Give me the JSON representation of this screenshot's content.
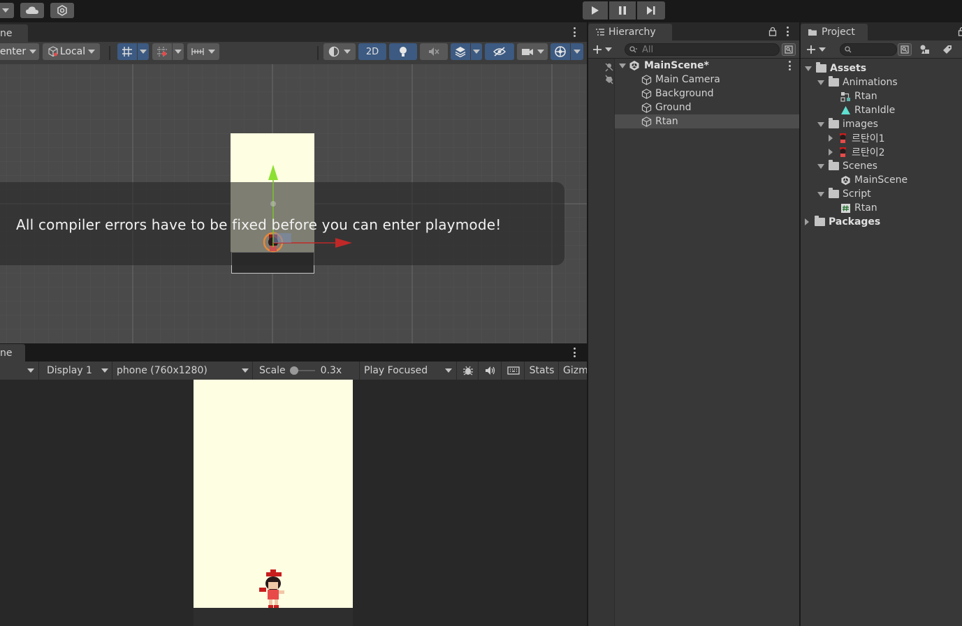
{
  "toolbar": {
    "play": "play-icon",
    "pause": "pause-icon",
    "step": "step-icon"
  },
  "scene": {
    "tab_label": "ne",
    "pivot_label": "enter",
    "space_label": "Local",
    "mode_2d_label": "2D",
    "overlay_message": "All compiler errors have to be fixed before you can enter playmode!"
  },
  "game": {
    "tab_label": "ne",
    "display_label": "Display 1",
    "resolution_label": "phone (760x1280)",
    "scale_label": "Scale",
    "scale_value": "0.3x",
    "play_mode_label": "Play Focused",
    "stats_label": "Stats",
    "gizmos_label": "Gizm"
  },
  "hierarchy": {
    "tab_label": "Hierarchy",
    "search_placeholder": "All",
    "scene_name": "MainScene*",
    "items": [
      "Main Camera",
      "Background",
      "Ground",
      "Rtan"
    ]
  },
  "project": {
    "tab_label": "Project",
    "assets_label": "Assets",
    "animations_label": "Animations",
    "anim_items": [
      "Rtan",
      "RtanIdle"
    ],
    "images_label": "images",
    "image_items": [
      "르탄이1",
      "르탄이2"
    ],
    "scenes_label": "Scenes",
    "scene_items": [
      "MainScene"
    ],
    "script_label": "Script",
    "script_items": [
      "Rtan"
    ],
    "packages_label": "Packages"
  },
  "colors": {
    "panel_bg": "#383838",
    "toolbar_bg": "#191919",
    "selection": "#4d4d4d",
    "accent_blue": "#3c5a82",
    "sky": "#fefee2"
  }
}
